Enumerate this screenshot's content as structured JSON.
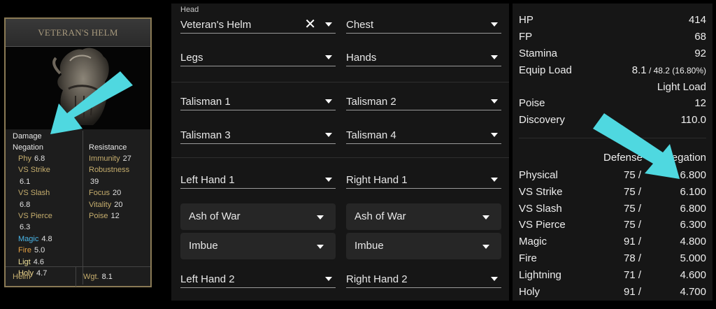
{
  "card": {
    "title": "VETERAN'S HELM",
    "damage_label": "Damage",
    "negation_label": "Negation",
    "resistance_label": "Resistance",
    "negation": [
      {
        "name": "Phy",
        "value": "6.8",
        "style": ""
      },
      {
        "name": "VS Strike",
        "value": "",
        "style": ""
      },
      {
        "name": "",
        "value": "6.1",
        "style": ""
      },
      {
        "name": "VS Slash",
        "value": "",
        "style": ""
      },
      {
        "name": "",
        "value": "6.8",
        "style": ""
      },
      {
        "name": "VS Pierce",
        "value": "",
        "style": ""
      },
      {
        "name": "",
        "value": "6.3",
        "style": ""
      },
      {
        "name": "Magic",
        "value": "4.8",
        "style": "magic"
      },
      {
        "name": "Fire",
        "value": "5.0",
        "style": "fire"
      },
      {
        "name": "Ligt",
        "value": "4.6",
        "style": "ligt"
      },
      {
        "name": "Holy",
        "value": "4.7",
        "style": "holy"
      }
    ],
    "resistance": [
      {
        "name": "Immunity",
        "value": "27"
      },
      {
        "name": "Robustness",
        "value": ""
      },
      {
        "name": "",
        "value": "39"
      },
      {
        "name": "Focus",
        "value": "20"
      },
      {
        "name": "Vitality",
        "value": "20"
      },
      {
        "name": "Poise",
        "value": "12"
      }
    ],
    "footer_type": "Helm",
    "footer_weight_label": "Wgt.",
    "footer_weight": "8.1"
  },
  "equipment": {
    "head_label": "Head",
    "head_value": "Veteran's Helm",
    "chest": "Chest",
    "legs": "Legs",
    "hands": "Hands",
    "talisman1": "Talisman 1",
    "talisman2": "Talisman 2",
    "talisman3": "Talisman 3",
    "talisman4": "Talisman 4",
    "left_hand1": "Left Hand 1",
    "right_hand1": "Right Hand 1",
    "ash_of_war_left": "Ash of War",
    "ash_of_war_right": "Ash of War",
    "imbue_left": "Imbue",
    "imbue_right": "Imbue",
    "left_hand2": "Left Hand 2",
    "right_hand2": "Right Hand 2"
  },
  "stats": {
    "hp_label": "HP",
    "hp": "414",
    "fp_label": "FP",
    "fp": "68",
    "stamina_label": "Stamina",
    "stamina": "92",
    "equip_load_label": "Equip Load",
    "equip_load": "8.1",
    "equip_load_detail": " / 48.2 (16.80%)",
    "load_class": "Light Load",
    "poise_label": "Poise",
    "poise": "12",
    "discovery_label": "Discovery",
    "discovery": "110.0",
    "defense_header": "Defense",
    "negation_header": "Negation",
    "rows": [
      {
        "name": "Physical",
        "defense": "75 /",
        "negation": "6.800"
      },
      {
        "name": "VS Strike",
        "defense": "75 /",
        "negation": "6.100"
      },
      {
        "name": "VS Slash",
        "defense": "75 /",
        "negation": "6.800"
      },
      {
        "name": "VS Pierce",
        "defense": "75 /",
        "negation": "6.300"
      },
      {
        "name": "Magic",
        "defense": "91 /",
        "negation": "4.800"
      },
      {
        "name": "Fire",
        "defense": "78 /",
        "negation": "5.000"
      },
      {
        "name": "Lightning",
        "defense": "71 /",
        "negation": "4.600"
      },
      {
        "name": "Holy",
        "defense": "91 /",
        "negation": "4.700"
      }
    ]
  },
  "colors": {
    "arrow": "#4fd8e0",
    "card_border": "#8a7a55"
  }
}
